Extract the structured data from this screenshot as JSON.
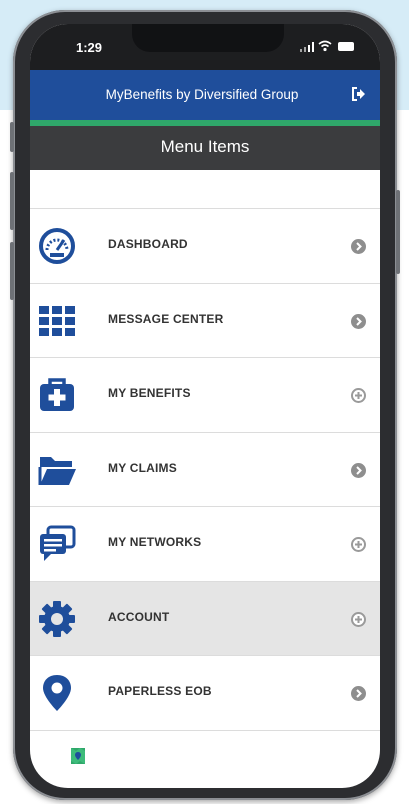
{
  "status_bar": {
    "time": "1:29"
  },
  "header": {
    "title": "MyBenefits by Diversified Group",
    "logout_icon": "logout-arrow-icon",
    "color": "#1f4e9b",
    "stripe_color": "#2fa76a"
  },
  "menu_bar": {
    "title": "Menu Items",
    "color": "#3b3c3e"
  },
  "menu": {
    "items": [
      {
        "label": "DASHBOARD",
        "icon": "speedometer-icon"
      },
      {
        "label": "MESSAGE CENTER",
        "icon": "grid-icon"
      },
      {
        "label": "MY BENEFITS",
        "icon": "medical-bag-icon"
      },
      {
        "label": "MY CLAIMS",
        "icon": "folder-icon"
      },
      {
        "label": "MY NETWORKS",
        "icon": "chat-bubbles-icon"
      },
      {
        "label": "ACCOUNT",
        "icon": "gear-icon"
      },
      {
        "label": "PAPERLESS EOB",
        "icon": "location-pin-icon"
      }
    ],
    "active_item": "ACCOUNT",
    "icon_color": "#1f4e9b"
  }
}
